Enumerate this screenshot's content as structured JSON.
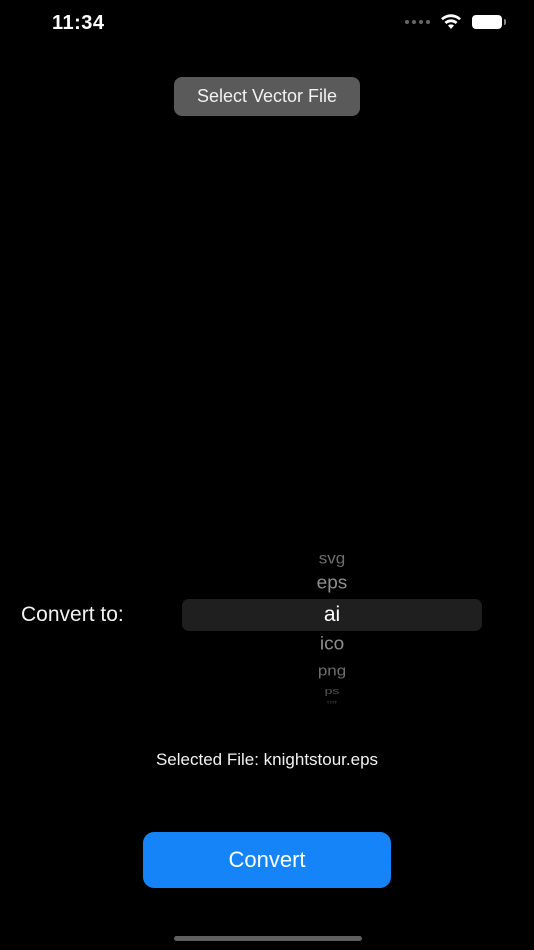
{
  "status_bar": {
    "time": "11:34",
    "icons": [
      "cellular-dots-icon",
      "wifi-icon",
      "battery-icon"
    ]
  },
  "select_button": {
    "label": "Select Vector File"
  },
  "convert_to": {
    "label": "Convert to:"
  },
  "picker": {
    "items": [
      "svg",
      "eps",
      "ai",
      "ico",
      "png",
      "ps",
      "tiff"
    ],
    "selected": "ai"
  },
  "selected_file": {
    "text": "Selected File: knightstour.eps"
  },
  "convert_button": {
    "label": "Convert"
  },
  "colors": {
    "background": "#000000",
    "accent": "#1584f8",
    "secondary_button": "#5a5a5a"
  }
}
